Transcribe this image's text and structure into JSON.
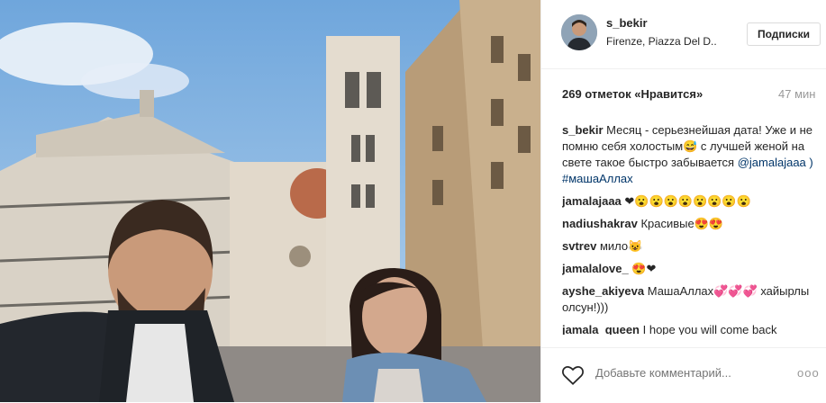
{
  "header": {
    "username": "s_bekir",
    "location": "Firenze, Piazza Del D..",
    "follow_label": "Подписки"
  },
  "likes_text": "269 отметок «Нравится»",
  "time_text": "47 мин",
  "comments": [
    {
      "user": "s_bekir",
      "text": "Месяц - серьезнейшая дата! Уже и не помню себя холостым😅 с лучшей женой на свете такое быстро забывается ",
      "mention": "@jamalajaaa",
      "tail": " ) #машаАллах"
    },
    {
      "user": "jamalajaaa",
      "text": "❤😮😮😮😮😮😮😮😮"
    },
    {
      "user": "nadiushakrav",
      "text": "Красивые😍😍"
    },
    {
      "user": "svtrev",
      "text": "мило😺"
    },
    {
      "user": "jamalalove_",
      "text": "😍❤"
    },
    {
      "user": "ayshe_akiyeva",
      "text": "МашаАллах💞💞💞 хайырлы олсун!)))"
    },
    {
      "user": "jamala_queen",
      "text": "I hope you will come back"
    }
  ],
  "comment_placeholder": "Добавьте комментарий...",
  "more_label": "ooo",
  "colors": {
    "link": "#003569",
    "muted": "#999999",
    "border": "#efefef"
  }
}
